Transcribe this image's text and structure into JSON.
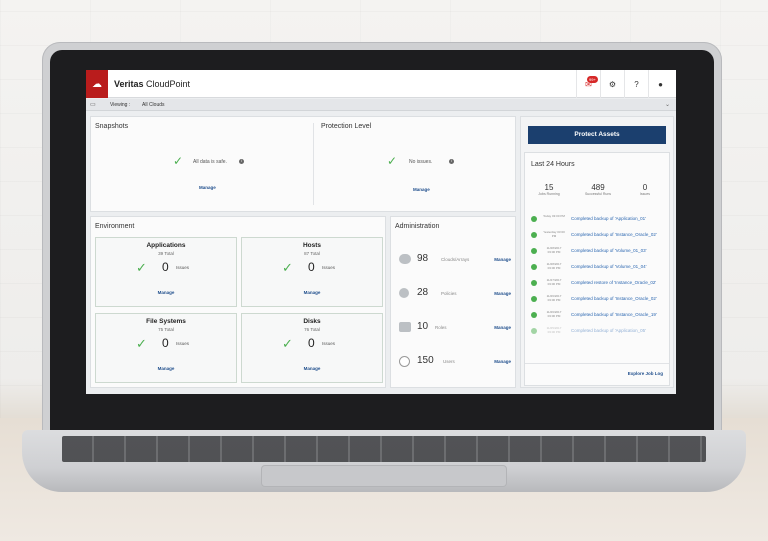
{
  "app": {
    "logo": "☁",
    "title_bold": "Veritas",
    "title_rest": " CloudPoint"
  },
  "topbar": {
    "notification_badge": "99+",
    "notification_icon": "✉",
    "settings_icon": "⚙",
    "help_icon": "?",
    "user_icon": "●"
  },
  "viewbar": {
    "label": "Viewing :",
    "value": "All Clouds"
  },
  "snapshots": {
    "title": "Snapshots",
    "status": "All data is safe.",
    "manage": "Manage"
  },
  "protection": {
    "title": "Protection Level",
    "status": "No issues.",
    "manage": "Manage"
  },
  "environment": {
    "title": "Environment",
    "cards": [
      {
        "title": "Applications",
        "total": "39 Total",
        "count": "0",
        "issues": "Issues",
        "manage": "Manage"
      },
      {
        "title": "Hosts",
        "total": "87 Total",
        "count": "0",
        "issues": "Issues",
        "manage": "Manage"
      },
      {
        "title": "File Systems",
        "total": "75 Total",
        "count": "0",
        "issues": "Issues",
        "manage": "Manage"
      },
      {
        "title": "Disks",
        "total": "76 Total",
        "count": "0",
        "issues": "Issues",
        "manage": "Manage"
      }
    ]
  },
  "administration": {
    "title": "Administration",
    "rows": [
      {
        "num": "98",
        "label": "Clouds/Arrays",
        "manage": "Manage"
      },
      {
        "num": "28",
        "label": "Policies",
        "manage": "Manage"
      },
      {
        "num": "10",
        "label": "Roles",
        "manage": "Manage"
      },
      {
        "num": "150",
        "label": "Users",
        "manage": "Manage"
      }
    ]
  },
  "right": {
    "protect_button": "Protect Assets",
    "title": "Last 24 Hours",
    "stats": [
      {
        "num": "15",
        "label": "Jobs Running"
      },
      {
        "num": "489",
        "label": "Successful Runs"
      },
      {
        "num": "0",
        "label": "Issues"
      }
    ],
    "jobs": [
      {
        "time": "Today 03:00 PM",
        "text": "Completed backup of 'Application_01'"
      },
      {
        "time": "Yesterday 03:00 PM",
        "text": "Completed backup of 'Instance_Oracle_02'"
      },
      {
        "time": "11/28/2017 03:00 PM",
        "text": "Completed backup of 'Volume_01_03'"
      },
      {
        "time": "11/28/2017 03:00 PM",
        "text": "Completed backup of 'Volume_01_04'"
      },
      {
        "time": "11/27/2017 03:00 PM",
        "text": "Completed restore of 'Instance_Oracle_02'"
      },
      {
        "time": "11/26/2017 03:00 PM",
        "text": "Completed backup of 'Instance_Oracle_02'"
      },
      {
        "time": "11/26/2017 03:00 PM",
        "text": "Completed backup of 'Instance_Oracle_19'"
      },
      {
        "time": "11/25/2017 03:00 PM",
        "text": "Completed backup of 'Application_05'"
      }
    ],
    "explore": "Explore Job Log"
  }
}
